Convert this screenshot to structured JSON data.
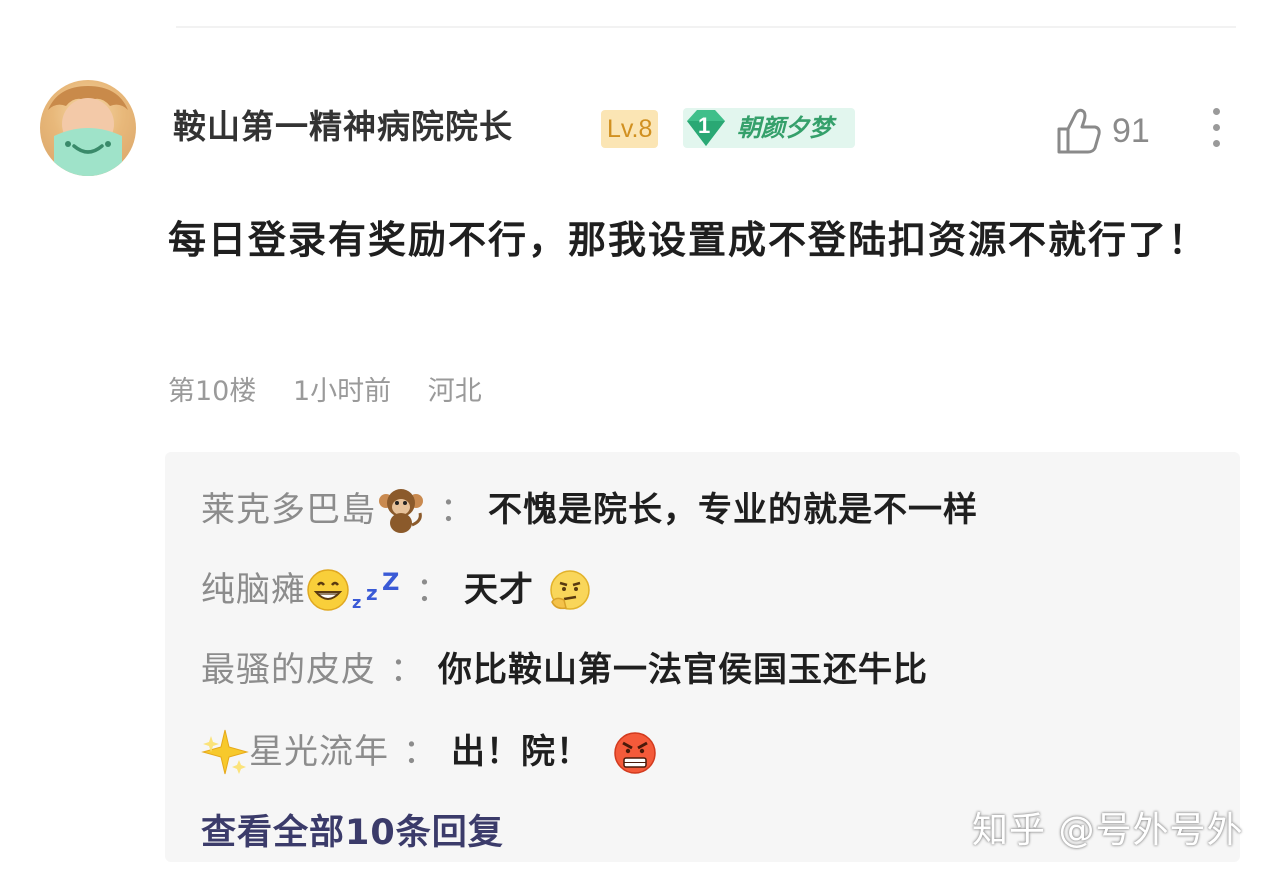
{
  "comment": {
    "author": "鞍山第一精神病院院长",
    "level_badge": "Lv.8",
    "group_badge": {
      "number": "1",
      "name": "朝颜夕梦"
    },
    "like_count": "91",
    "text": "每日登录有奖励不行，那我设置成不登陆扣资源不就行了！",
    "floor": "第10楼",
    "time": "1小时前",
    "location": "河北"
  },
  "replies": [
    {
      "author": "莱克多巴島",
      "separator": "：",
      "text": "不愧是院长，专业的就是不一样"
    },
    {
      "author": "纯脑瘫",
      "separator": "：",
      "text": "天才"
    },
    {
      "author": "最骚的皮皮",
      "separator": "：",
      "text": "你比鞍山第一法官侯国玉还牛比"
    },
    {
      "author": "星光流年",
      "separator": "：",
      "text": "出！院！"
    }
  ],
  "view_all_label": "查看全部10条回复",
  "watermark": "知乎 @号外号外",
  "icons": [
    "avatar",
    "like-icon",
    "more-icon",
    "monkey-emoji",
    "grin-emoji",
    "zzz-emoji",
    "thinking-emoji",
    "sparkle-emoji",
    "angry-emoji",
    "group-icon"
  ],
  "colors": {
    "level_badge_bg": "#fbe5b4",
    "level_badge_text": "#d19020",
    "group_badge_bg": "#e2f6ee",
    "group_badge_text": "#35a06b",
    "reply_bg": "#f6f6f6",
    "view_all": "#3b3b6a"
  }
}
